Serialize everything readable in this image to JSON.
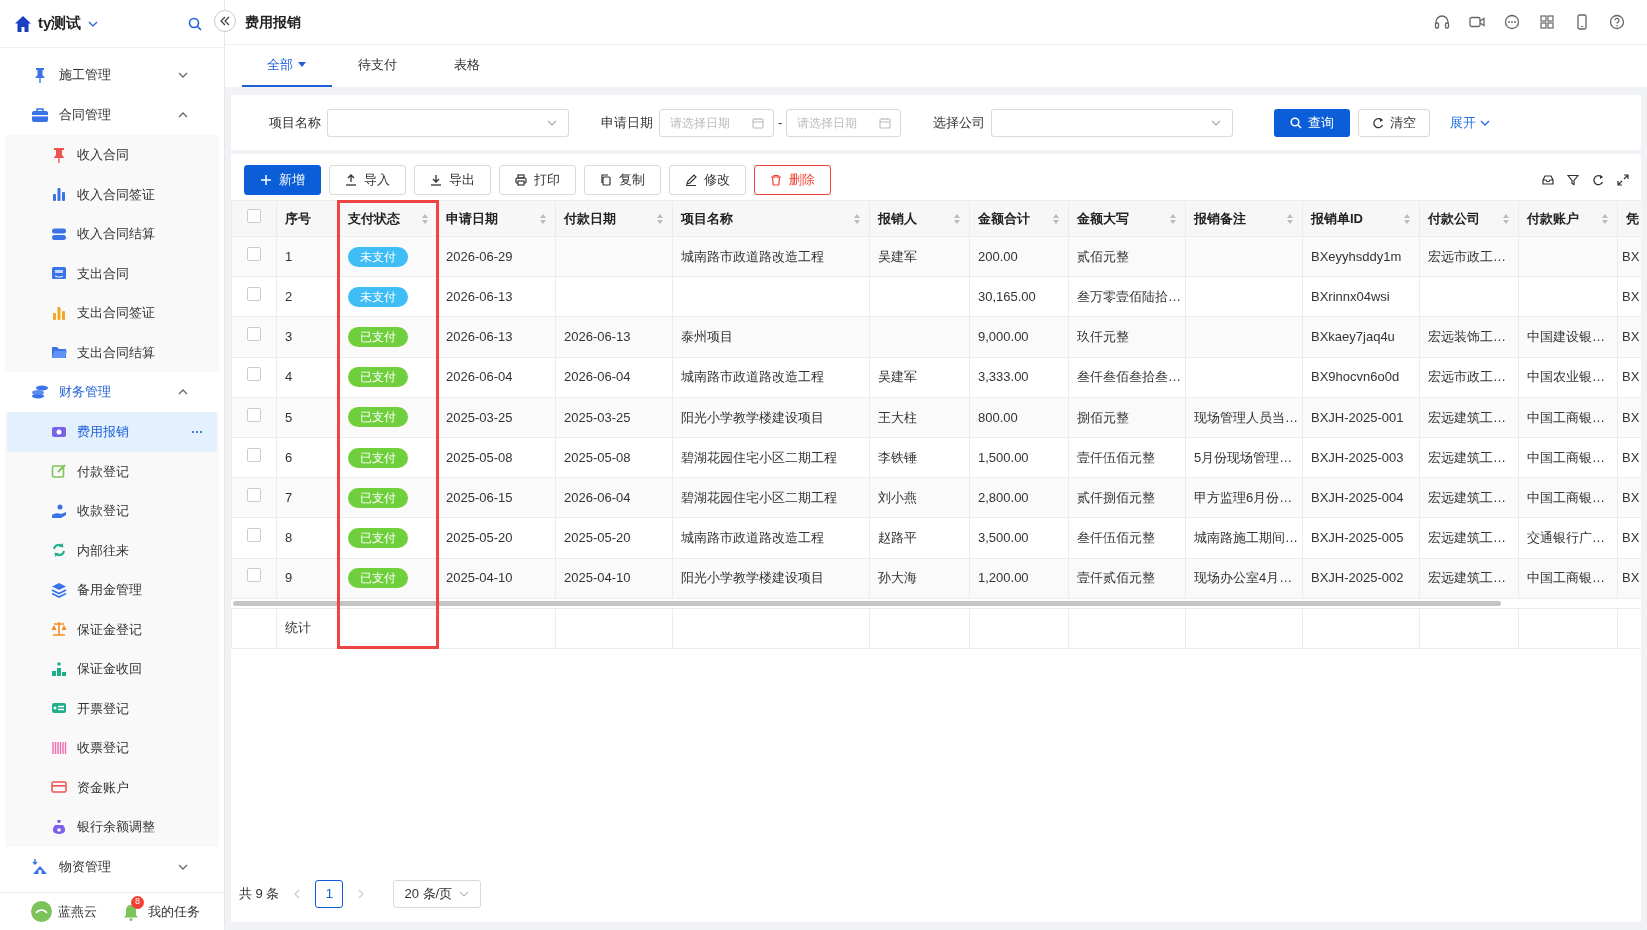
{
  "sidebar": {
    "workspace": "ty测试",
    "sections": [
      {
        "label": "施工管理",
        "expanded": false,
        "active": false
      },
      {
        "label": "合同管理",
        "expanded": true,
        "active": false,
        "children": [
          {
            "label": "收入合同",
            "selected": false
          },
          {
            "label": "收入合同签证",
            "selected": false
          },
          {
            "label": "收入合同结算",
            "selected": false
          },
          {
            "label": "支出合同",
            "selected": false
          },
          {
            "label": "支出合同签证",
            "selected": false
          },
          {
            "label": "支出合同结算",
            "selected": false
          }
        ]
      },
      {
        "label": "财务管理",
        "expanded": true,
        "active": true,
        "children": [
          {
            "label": "费用报销",
            "selected": true
          },
          {
            "label": "付款登记",
            "selected": false
          },
          {
            "label": "收款登记",
            "selected": false
          },
          {
            "label": "内部往来",
            "selected": false
          },
          {
            "label": "备用金管理",
            "selected": false
          },
          {
            "label": "保证金登记",
            "selected": false
          },
          {
            "label": "保证金收回",
            "selected": false
          },
          {
            "label": "开票登记",
            "selected": false
          },
          {
            "label": "收票登记",
            "selected": false
          },
          {
            "label": "资金账户",
            "selected": false
          },
          {
            "label": "银行余额调整",
            "selected": false
          }
        ]
      },
      {
        "label": "物资管理",
        "expanded": false,
        "active": false
      }
    ],
    "footer": {
      "brand": "蓝燕云",
      "tasks": "我的任务",
      "task_count": "8"
    }
  },
  "page_title": "费用报销",
  "tabs": [
    {
      "label": "全部",
      "selected": true
    },
    {
      "label": "待支付",
      "selected": false
    },
    {
      "label": "表格",
      "selected": false
    }
  ],
  "filters": [
    {
      "kind": "select",
      "label": "项目名称"
    },
    {
      "kind": "daterange",
      "label": "申请日期",
      "placeholder": "请选择日期",
      "placeholder_end": "请选择日期",
      "separator": "-"
    },
    {
      "kind": "select",
      "label": "选择公司"
    }
  ],
  "filter_buttons": [
    {
      "kind": "primary",
      "label": "查询"
    },
    {
      "kind": "default",
      "label": "清空"
    },
    {
      "kind": "link",
      "label": "展开"
    }
  ],
  "toolbar": [
    {
      "kind": "primary",
      "label": "新增"
    },
    {
      "kind": "default",
      "label": "导入"
    },
    {
      "kind": "default",
      "label": "导出"
    },
    {
      "kind": "default",
      "label": "打印"
    },
    {
      "kind": "default",
      "label": "复制"
    },
    {
      "kind": "default",
      "label": "修改"
    },
    {
      "kind": "danger",
      "label": "删除"
    }
  ],
  "table": {
    "header_checked": false,
    "columns": [
      "序号",
      "支付状态",
      "申请日期",
      "付款日期",
      "项目名称",
      "报销人",
      "金额合计",
      "金额大写",
      "报销备注",
      "报销单ID",
      "付款公司",
      "付款账户",
      "凭"
    ],
    "rows": [
      {
        "checked": false,
        "cells": [
          "1",
          {
            "text": "未支付",
            "color": "#3fbdf5"
          },
          "2026-06-29",
          "",
          "城南路市政道路改造工程",
          "吴建军",
          "200.00",
          "贰佰元整",
          "",
          "BXeyyhsddy1m",
          "宏远市政工…",
          "",
          "BX"
        ]
      },
      {
        "checked": false,
        "cells": [
          "2",
          {
            "text": "未支付",
            "color": "#3fbdf5"
          },
          "2026-06-13",
          "",
          "",
          "",
          "30,165.00",
          "叁万零壹佰陆拾…",
          "",
          "BXrinnx04wsi",
          "",
          "",
          "BX"
        ]
      },
      {
        "checked": false,
        "cells": [
          "3",
          {
            "text": "已支付",
            "color": "#6fcf3d"
          },
          "2026-06-13",
          "2026-06-13",
          "泰州项目",
          "",
          "9,000.00",
          "玖仟元整",
          "",
          "BXkaey7jaq4u",
          "宏远装饰工…",
          "中国建设银…",
          "BX"
        ]
      },
      {
        "checked": false,
        "cells": [
          "4",
          {
            "text": "已支付",
            "color": "#6fcf3d"
          },
          "2026-06-04",
          "2026-06-04",
          "城南路市政道路改造工程",
          "吴建军",
          "3,333.00",
          "叁仟叁佰叁拾叁…",
          "",
          "BX9hocvn6o0d",
          "宏远市政工…",
          "中国农业银…",
          "BX"
        ]
      },
      {
        "checked": false,
        "cells": [
          "5",
          {
            "text": "已支付",
            "color": "#6fcf3d"
          },
          "2025-03-25",
          "2025-03-25",
          "阳光小学教学楼建设项目",
          "王大柱",
          "800.00",
          "捌佰元整",
          "现场管理人员当…",
          "BXJH-2025-001",
          "宏远建筑工…",
          "中国工商银…",
          "BX"
        ]
      },
      {
        "checked": false,
        "cells": [
          "6",
          {
            "text": "已支付",
            "color": "#6fcf3d"
          },
          "2025-05-08",
          "2025-05-08",
          "碧湖花园住宅小区二期工程",
          "李铁锤",
          "1,500.00",
          "壹仟伍佰元整",
          "5月份现场管理…",
          "BXJH-2025-003",
          "宏远建筑工…",
          "中国工商银…",
          "BX"
        ]
      },
      {
        "checked": false,
        "cells": [
          "7",
          {
            "text": "已支付",
            "color": "#6fcf3d"
          },
          "2025-06-15",
          "2026-06-04",
          "碧湖花园住宅小区二期工程",
          "刘小燕",
          "2,800.00",
          "贰仟捌佰元整",
          "甲方监理6月份…",
          "BXJH-2025-004",
          "宏远建筑工…",
          "中国工商银…",
          "BX"
        ]
      },
      {
        "checked": false,
        "cells": [
          "8",
          {
            "text": "已支付",
            "color": "#6fcf3d"
          },
          "2025-05-20",
          "2025-05-20",
          "城南路市政道路改造工程",
          "赵路平",
          "3,500.00",
          "叁仟伍佰元整",
          "城南路施工期间…",
          "BXJH-2025-005",
          "宏远建筑工…",
          "交通银行广…",
          "BX"
        ]
      },
      {
        "checked": false,
        "cells": [
          "9",
          {
            "text": "已支付",
            "color": "#6fcf3d"
          },
          "2025-04-10",
          "2025-04-10",
          "阳光小学教学楼建设项目",
          "孙大海",
          "1,200.00",
          "壹仟贰佰元整",
          "现场办公室4月…",
          "BXJH-2025-002",
          "宏远建筑工…",
          "中国工商银…",
          "BX"
        ]
      }
    ],
    "summary_label": "统计"
  },
  "pagination": {
    "total": "共 9 条",
    "current_page": "1",
    "page_size": "20 条/页"
  }
}
